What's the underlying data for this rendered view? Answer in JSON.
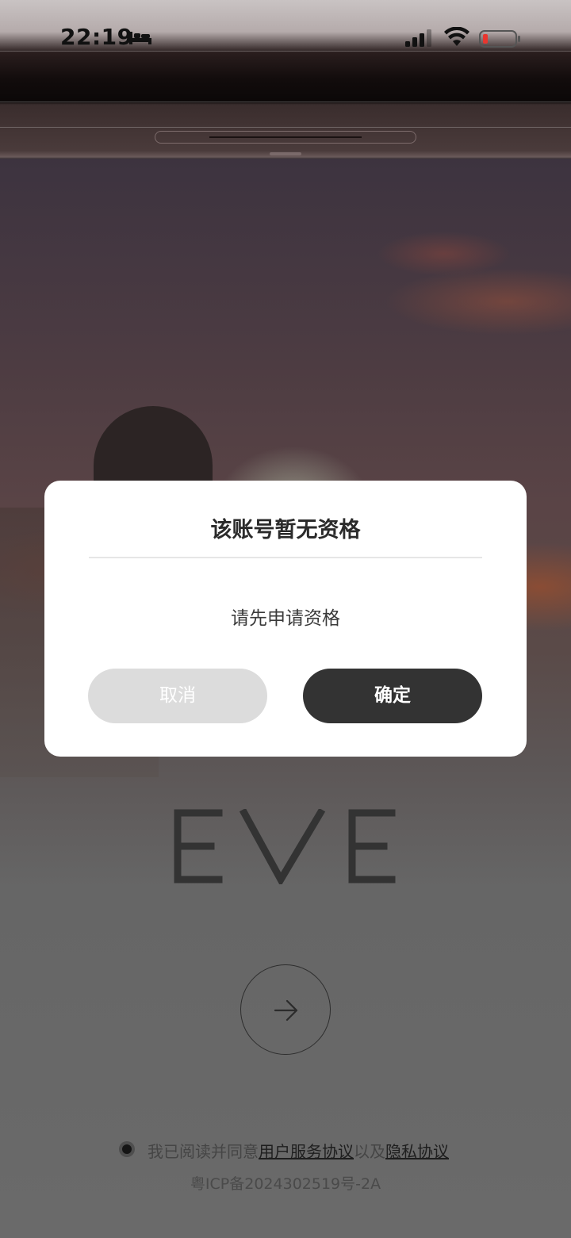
{
  "status_bar": {
    "time": "22:19",
    "icons": [
      "bed-icon",
      "signal-icon",
      "wifi-icon",
      "battery-low-icon"
    ],
    "battery_color": "#e8362f"
  },
  "logo": {
    "text": "EVE"
  },
  "agreement": {
    "prefix": "我已阅读并同意",
    "user_service_link": "用户服务协议",
    "connector": "以及",
    "privacy_link": "隐私协议"
  },
  "icp": "粤ICP备2024302519号-2A",
  "dialog": {
    "title": "该账号暂无资格",
    "message": "请先申请资格",
    "cancel_label": "取消",
    "confirm_label": "确定"
  },
  "colors": {
    "dialog_bg": "#ffffff",
    "cancel_bg": "#dcdcdc",
    "confirm_bg": "#333333"
  }
}
